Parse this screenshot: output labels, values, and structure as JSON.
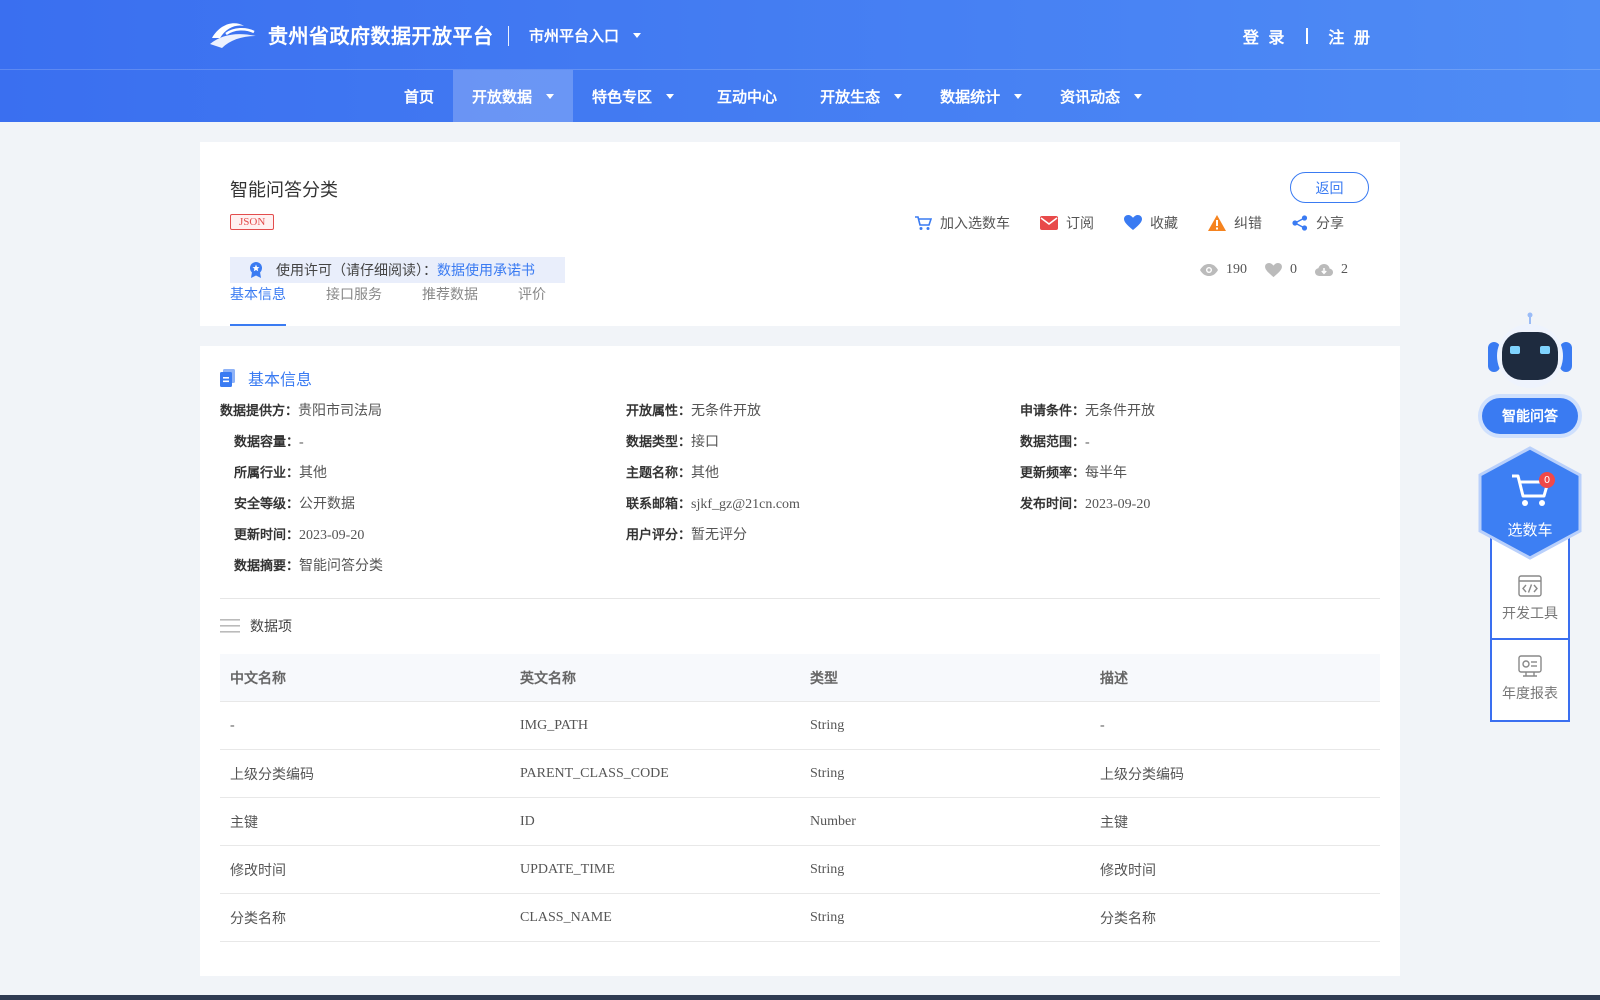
{
  "header": {
    "site_title": "贵州省政府数据开放平台",
    "city_entry": "市州平台入口",
    "login": "登 录",
    "register": "注 册"
  },
  "nav": {
    "items": [
      {
        "label": "首页",
        "has_dropdown": false,
        "active": false
      },
      {
        "label": "开放数据",
        "has_dropdown": true,
        "active": true
      },
      {
        "label": "特色专区",
        "has_dropdown": true,
        "active": false
      },
      {
        "label": "互动中心",
        "has_dropdown": false,
        "active": false
      },
      {
        "label": "开放生态",
        "has_dropdown": true,
        "active": false
      },
      {
        "label": "数据统计",
        "has_dropdown": true,
        "active": false
      },
      {
        "label": "资讯动态",
        "has_dropdown": true,
        "active": false
      }
    ]
  },
  "dataset": {
    "title": "智能问答分类",
    "format_tag": "JSON",
    "back_label": "返回",
    "actions": {
      "cart": "加入选数车",
      "subscribe": "订阅",
      "favorite": "收藏",
      "report": "纠错",
      "share": "分享"
    },
    "license_label": "使用许可（请仔细阅读）：",
    "license_link": "数据使用承诺书",
    "stats": {
      "views": "190",
      "likes": "0",
      "downloads": "2"
    },
    "tabs": [
      "基本信息",
      "接口服务",
      "推荐数据",
      "评价"
    ]
  },
  "basic_info": {
    "section_title": "基本信息",
    "fields": {
      "provider_k": "数据提供方：",
      "provider_v": "贵阳市司法局",
      "open_attr_k": "开放属性：",
      "open_attr_v": "无条件开放",
      "apply_cond_k": "申请条件：",
      "apply_cond_v": "无条件开放",
      "capacity_k": "数据容量：",
      "capacity_v": "-",
      "data_type_k": "数据类型：",
      "data_type_v": "接口",
      "range_k": "数据范围：",
      "range_v": "-",
      "industry_k": "所属行业：",
      "industry_v": "其他",
      "topic_k": "主题名称：",
      "topic_v": "其他",
      "frequency_k": "更新频率：",
      "frequency_v": "每半年",
      "security_k": "安全等级：",
      "security_v": "公开数据",
      "email_k": "联系邮箱：",
      "email_v": "sjkf_gz@21cn.com",
      "publish_k": "发布时间：",
      "publish_v": "2023-09-20",
      "update_k": "更新时间：",
      "update_v": "2023-09-20",
      "rating_k": "用户评分：",
      "rating_v": "暂无评分",
      "summary_k": "数据摘要：",
      "summary_v": "智能问答分类"
    }
  },
  "data_items": {
    "section_title": "数据项",
    "columns": [
      "中文名称",
      "英文名称",
      "类型",
      "描述"
    ],
    "rows": [
      [
        "-",
        "IMG_PATH",
        "String",
        "-"
      ],
      [
        "上级分类编码",
        "PARENT_CLASS_CODE",
        "String",
        "上级分类编码"
      ],
      [
        "主键",
        "ID",
        "Number",
        "主键"
      ],
      [
        "修改时间",
        "UPDATE_TIME",
        "String",
        "修改时间"
      ],
      [
        "分类名称",
        "CLASS_NAME",
        "String",
        "分类名称"
      ]
    ]
  },
  "sidebar": {
    "ai_label": "智能问答",
    "cart_label": "选数车",
    "cart_count": "0",
    "dev_tools": "开发工具",
    "annual_report": "年度报表"
  },
  "colors": {
    "brand_blue": "#3a7bf2",
    "header_gradient_start": "#3a6ff0",
    "tag_red": "#e34d4d",
    "warning_orange": "#f5831f"
  }
}
